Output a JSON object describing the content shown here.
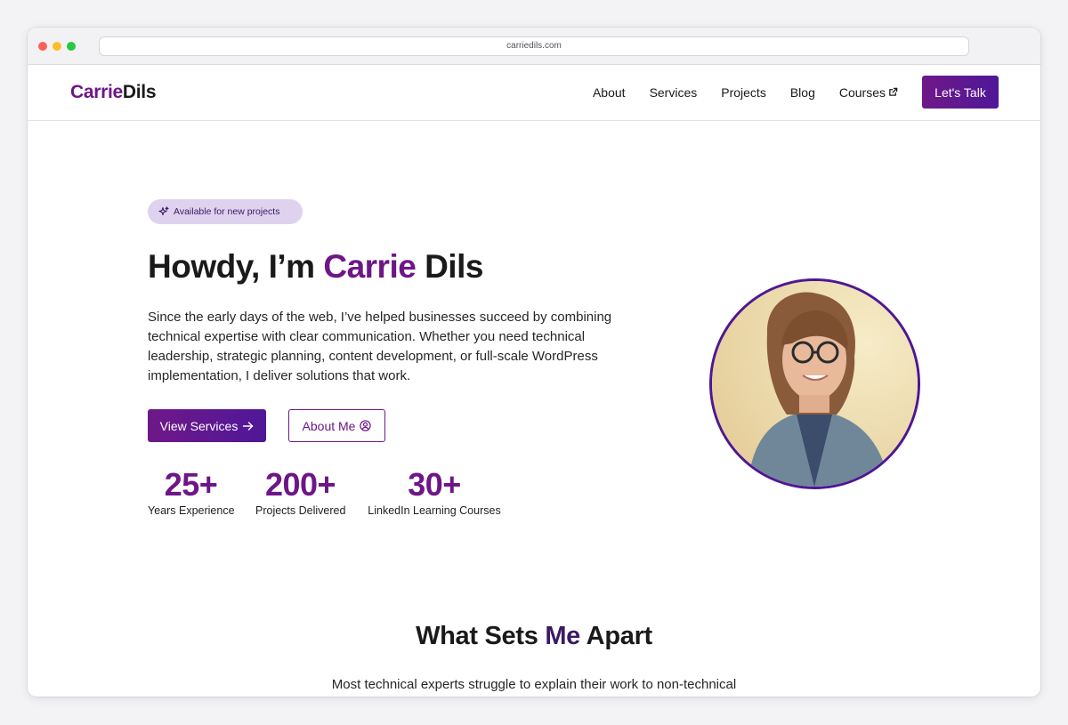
{
  "browser": {
    "url": "carriedils.com"
  },
  "header": {
    "logo_first": "Carrie",
    "logo_last": "Dils",
    "nav": [
      "About",
      "Services",
      "Projects",
      "Blog",
      "Courses"
    ],
    "cta": "Let's Talk"
  },
  "hero": {
    "badge": "Available for new projects",
    "headline_pre": "Howdy, I’m ",
    "headline_accent": "Carrie",
    "headline_post": " Dils",
    "intro": "Since the early days of the web, I’ve helped businesses succeed by combining technical expertise with clear communication. Whether you need technical leadership, strategic planning, content development, or full-scale WordPress implementation, I deliver solutions that work.",
    "primary_button": "View Services",
    "secondary_button": "About Me",
    "stats": [
      {
        "value": "25+",
        "label": "Years Experience"
      },
      {
        "value": "200+",
        "label": "Projects Delivered"
      },
      {
        "value": "30+",
        "label": "LinkedIn Learning Courses"
      }
    ]
  },
  "apart": {
    "title_pre": "What Sets ",
    "title_accent": "Me",
    "title_post": " Apart",
    "intro": "Most technical experts struggle to explain their work to non-technical"
  },
  "colors": {
    "brand": "#6e1688",
    "brand_dark": "#4f1798",
    "badge_bg": "#dfd2ee"
  },
  "icons": {
    "badge": "sparkles-icon",
    "courses": "external-link-icon",
    "view_services": "arrow-right-icon",
    "about_me": "user-circle-icon"
  }
}
